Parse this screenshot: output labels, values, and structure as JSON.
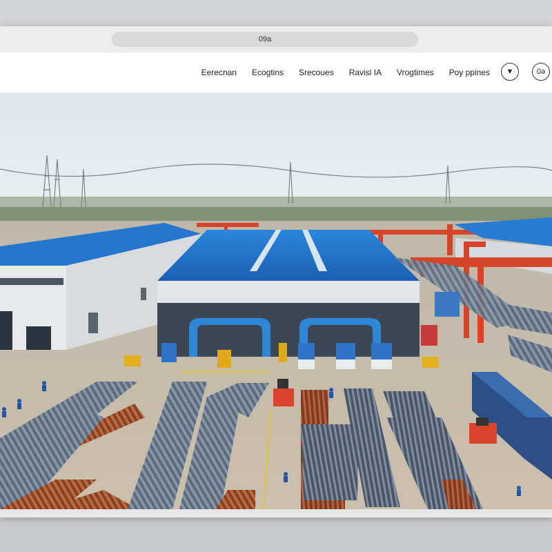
{
  "browser": {
    "url_text": "09a"
  },
  "nav": {
    "links": [
      "Eerecnan",
      "Ecogtins",
      "Srecoues",
      "Ravisl IA",
      "Vrogtimes",
      "Poy ppines"
    ],
    "icon_button_1_label": "▼",
    "icon_button_1_icon": "chevron-down-icon",
    "icon_button_2_label": "0ə",
    "icon_button_2_icon": "account-icon"
  },
  "hero": {
    "description": "industrial-steel-pipe-yard-photo",
    "colors": {
      "sky": "#e3eaee",
      "roof_blue": "#1f6fc4",
      "crane_red": "#d9482b",
      "ground": "#c6bba8",
      "pipe_steel": "#5c6c80",
      "pipe_rust": "#9a4a2a"
    }
  }
}
